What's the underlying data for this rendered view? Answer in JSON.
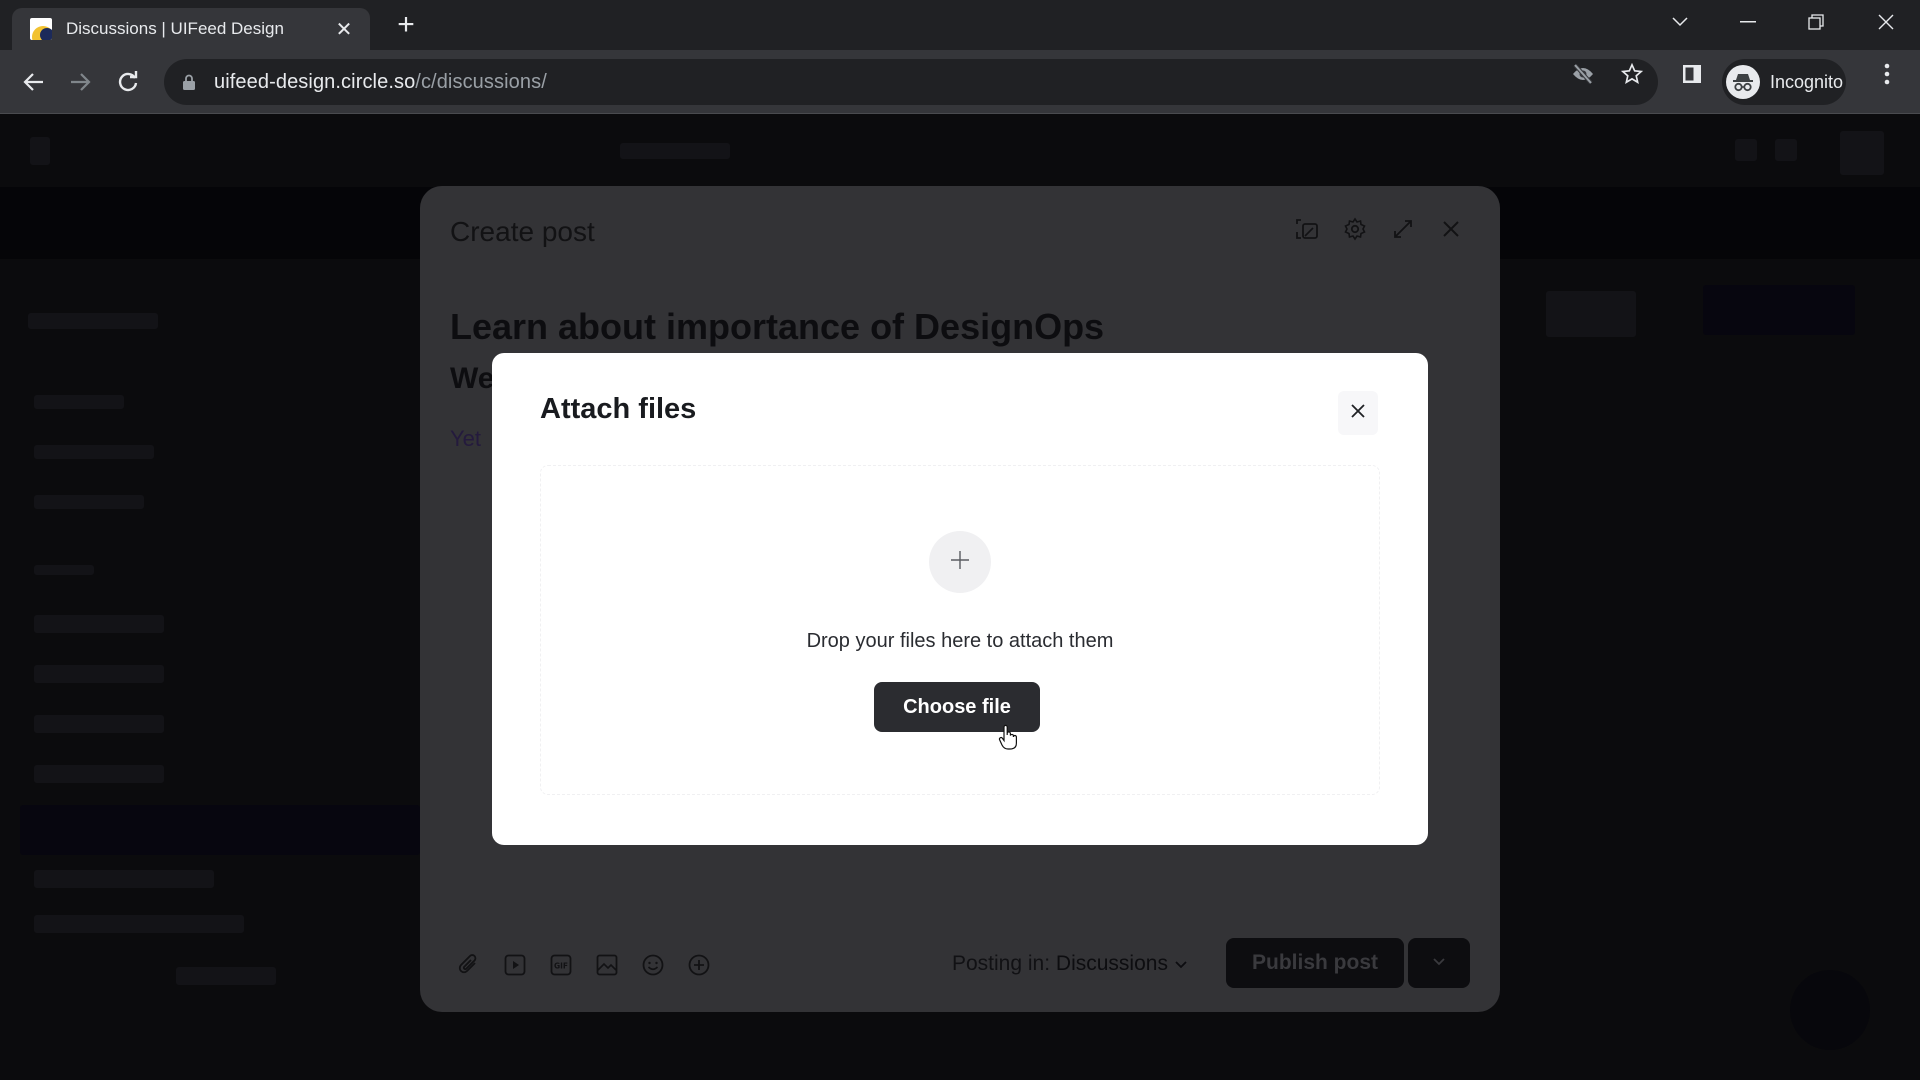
{
  "browser": {
    "tab": {
      "title": "Discussions | UIFeed Design",
      "favicon": "business-favicon"
    },
    "new_tab_label": "+",
    "address": {
      "host": "uifeed-design.circle.so",
      "path": "/c/discussions/"
    },
    "profile_label": "Incognito",
    "icons": [
      "back-icon",
      "forward-icon",
      "reload-icon",
      "lock-icon",
      "eye-off-icon",
      "star-icon",
      "side-panel-icon",
      "incognito-icon",
      "kebab-menu-icon",
      "tab-search-icon",
      "minimize-icon",
      "restore-icon",
      "close-window-icon"
    ]
  },
  "create_post": {
    "header": "Create post",
    "header_icons": [
      "cover-image-icon",
      "settings-icon",
      "expand-icon",
      "close-icon"
    ],
    "post_title": "Learn about importance of DesignOps",
    "body_line_1": "We",
    "body_line_2": "Yet",
    "toolbar_icons": [
      "attachment-icon",
      "video-icon",
      "gif-icon",
      "image-icon",
      "emoji-icon",
      "add-icon"
    ],
    "posting_in_label": "Posting in:",
    "posting_in_space": "Discussions",
    "publish_label": "Publish post"
  },
  "attach_files": {
    "title": "Attach files",
    "drop_hint": "Drop your files here to attach them",
    "choose_label": "Choose file"
  },
  "colors": {
    "chrome_bg": "#202124",
    "chrome_toolbar": "#35363a",
    "overlay_page": "#0b0b0d",
    "create_post_dimmed": "#333336",
    "modal_bg": "#ffffff",
    "primary_button": "#2b2c30"
  }
}
